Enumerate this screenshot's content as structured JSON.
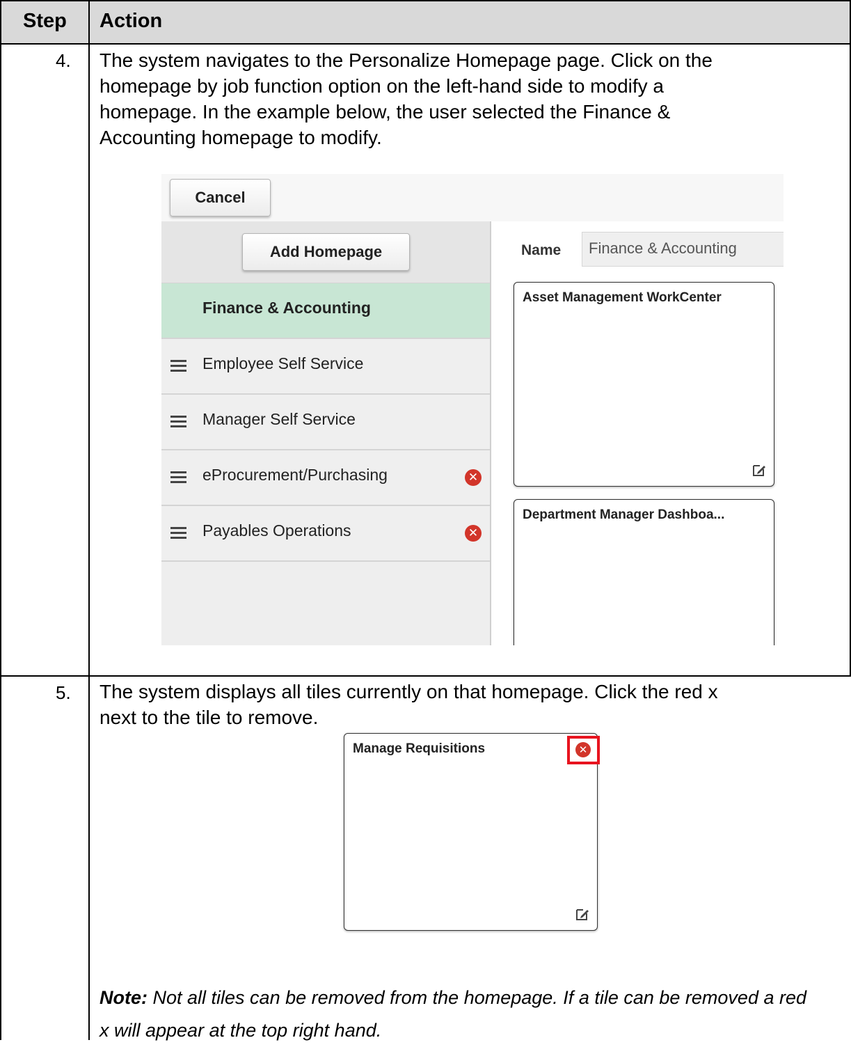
{
  "table": {
    "header": {
      "step": "Step",
      "action": "Action"
    },
    "rows": [
      {
        "step": "4.",
        "text_lines": [
          "The system navigates to the Personalize Homepage page. Click on the",
          "homepage by job function option on the left-hand side to modify a",
          "homepage. In the example below, the user selected the Finance &",
          "Accounting homepage to modify."
        ]
      },
      {
        "step": "5.",
        "text_lines": [
          "The system displays all tiles currently on that homepage. Click the red x",
          "next to the tile to remove."
        ],
        "note_label": "Note:",
        "note_text": " Not all tiles can be removed from the homepage. If a tile can be removed a red x will appear at the top right hand."
      }
    ]
  },
  "screenshot1": {
    "cancel_button": "Cancel",
    "add_homepage_button": "Add Homepage",
    "homepages": [
      {
        "label": "Finance & Accounting",
        "selected": true,
        "drag_handle": false,
        "removable": false
      },
      {
        "label": "Employee Self Service",
        "selected": false,
        "drag_handle": true,
        "removable": false
      },
      {
        "label": "Manager Self Service",
        "selected": false,
        "drag_handle": true,
        "removable": false
      },
      {
        "label": "eProcurement/Purchasing",
        "selected": false,
        "drag_handle": true,
        "removable": true
      },
      {
        "label": "Payables Operations",
        "selected": false,
        "drag_handle": true,
        "removable": true
      }
    ],
    "name_label": "Name",
    "name_value": "Finance & Accounting",
    "tiles": [
      {
        "title": "Asset Management WorkCenter"
      },
      {
        "title": "Department Manager Dashboa..."
      }
    ]
  },
  "screenshot2": {
    "tile_title": "Manage Requisitions"
  },
  "colors": {
    "header_bg": "#d9d9d9",
    "selected_item_bg": "#c8e6d4",
    "remove_icon": "#d2352a",
    "highlight_box": "#e8141f"
  },
  "icons": {
    "drag": "hamburger-icon",
    "remove": "remove-x-icon",
    "edit": "edit-icon"
  }
}
